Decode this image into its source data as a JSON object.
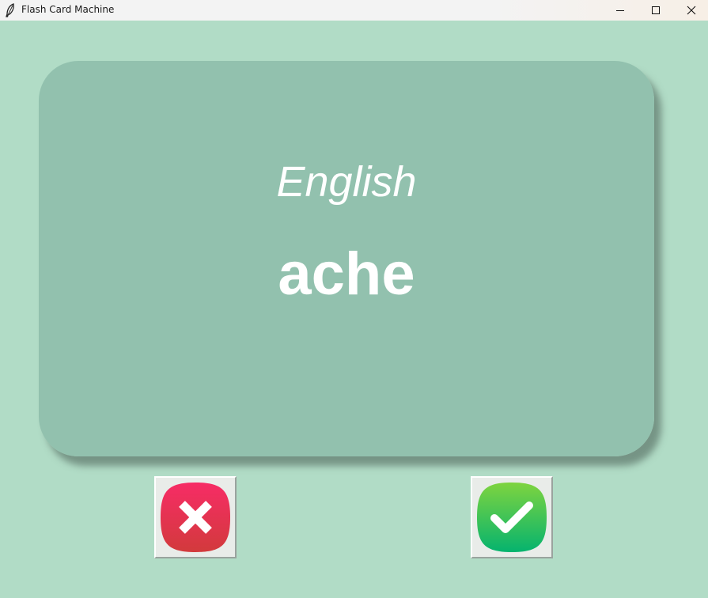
{
  "window": {
    "title": "Flash Card Machine",
    "icon": "feather-icon",
    "controls": [
      "minimize-icon",
      "maximize-icon",
      "close-icon"
    ]
  },
  "card": {
    "language": "English",
    "word": "ache"
  },
  "buttons": {
    "wrong": {
      "icon": "x-mark-icon",
      "color": "#e8314f"
    },
    "right": {
      "icon": "check-mark-icon",
      "color": "#1fbe63"
    }
  },
  "colors": {
    "background": "#b1dcc6",
    "card": "#92c1ae",
    "card_text": "#ffffff"
  }
}
